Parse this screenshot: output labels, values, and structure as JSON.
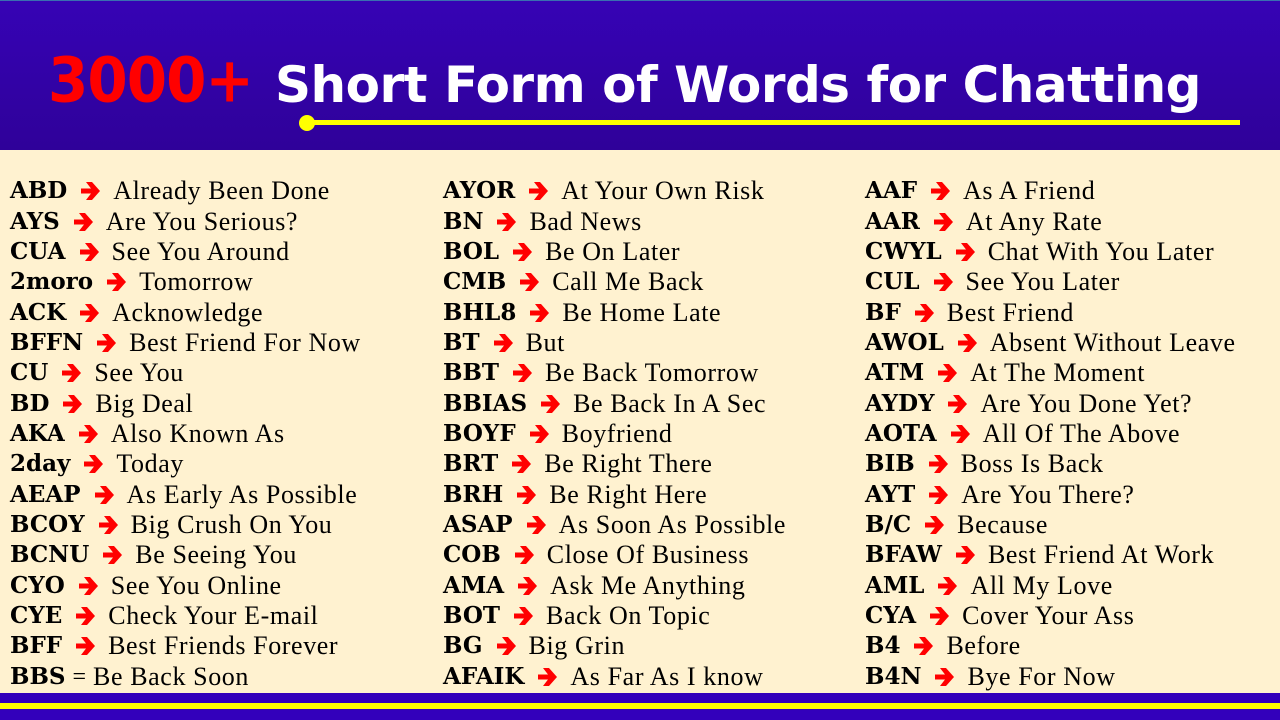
{
  "header": {
    "title_number": "3000+",
    "title_text": "Short Form of Words for Chatting"
  },
  "colors": {
    "header_bg": "#3603b5",
    "number_red": "#ff0000",
    "underline_yellow": "#ffff00",
    "arrow_red": "#ff0000",
    "body_bg": "#fff2d0"
  },
  "columns": [
    {
      "entries": [
        {
          "abbr": "ABD",
          "sep": "arrow",
          "meaning": "Already Been Done"
        },
        {
          "abbr": "AYS",
          "sep": "arrow",
          "meaning": "Are You Serious?"
        },
        {
          "abbr": "CUA",
          "sep": "arrow",
          "meaning": "See You Around"
        },
        {
          "abbr": "2moro",
          "sep": "arrow",
          "meaning": "Tomorrow"
        },
        {
          "abbr": "ACK",
          "sep": "arrow",
          "meaning": "Acknowledge"
        },
        {
          "abbr": "BFFN",
          "sep": "arrow",
          "meaning": "Best Friend For Now"
        },
        {
          "abbr": "CU",
          "sep": "arrow",
          "meaning": "See You"
        },
        {
          "abbr": "BD",
          "sep": "arrow",
          "meaning": "Big Deal"
        },
        {
          "abbr": "AKA",
          "sep": "arrow",
          "meaning": "Also Known As"
        },
        {
          "abbr": "2day",
          "sep": "arrow",
          "meaning": "Today"
        },
        {
          "abbr": "AEAP",
          "sep": "arrow",
          "meaning": "As Early As Possible"
        },
        {
          "abbr": "BCOY",
          "sep": "arrow",
          "meaning": "Big Crush On You"
        },
        {
          "abbr": "BCNU",
          "sep": "arrow",
          "meaning": "Be Seeing You"
        },
        {
          "abbr": "CYO",
          "sep": "arrow",
          "meaning": "See You Online"
        },
        {
          "abbr": "CYE",
          "sep": "arrow",
          "meaning": "Check Your E-mail"
        },
        {
          "abbr": "BFF",
          "sep": "arrow",
          "meaning": "Best Friends Forever"
        },
        {
          "abbr": "BBS",
          "sep": "=",
          "meaning": "Be Back Soon"
        }
      ]
    },
    {
      "entries": [
        {
          "abbr": "AYOR",
          "sep": "arrow",
          "meaning": "At Your Own Risk"
        },
        {
          "abbr": "BN",
          "sep": "arrow",
          "meaning": "Bad News"
        },
        {
          "abbr": "BOL",
          "sep": "arrow",
          "meaning": "Be On Later"
        },
        {
          "abbr": "CMB",
          "sep": "arrow",
          "meaning": "Call Me Back"
        },
        {
          "abbr": "BHL8",
          "sep": "arrow",
          "meaning": "Be Home Late"
        },
        {
          "abbr": "BT",
          "sep": "arrow",
          "meaning": "But"
        },
        {
          "abbr": "BBT",
          "sep": "arrow",
          "meaning": "Be Back Tomorrow"
        },
        {
          "abbr": "BBIAS",
          "sep": "arrow",
          "meaning": "Be Back In A Sec"
        },
        {
          "abbr": "BOYF",
          "sep": "arrow",
          "meaning": "Boyfriend"
        },
        {
          "abbr": "BRT",
          "sep": "arrow",
          "meaning": "Be Right There"
        },
        {
          "abbr": "BRH",
          "sep": "arrow",
          "meaning": "Be Right Here"
        },
        {
          "abbr": "ASAP",
          "sep": "arrow",
          "meaning": "As Soon As Possible"
        },
        {
          "abbr": "COB",
          "sep": "arrow",
          "meaning": "Close Of Business"
        },
        {
          "abbr": "AMA",
          "sep": "arrow",
          "meaning": "Ask Me Anything"
        },
        {
          "abbr": "BOT",
          "sep": "arrow",
          "meaning": "Back On Topic"
        },
        {
          "abbr": "BG",
          "sep": "arrow",
          "meaning": "Big Grin"
        },
        {
          "abbr": "AFAIK",
          "sep": "arrow",
          "meaning": "As Far As I know"
        }
      ]
    },
    {
      "entries": [
        {
          "abbr": "AAF",
          "sep": "arrow",
          "meaning": "As A Friend"
        },
        {
          "abbr": "AAR",
          "sep": "arrow",
          "meaning": "At Any Rate"
        },
        {
          "abbr": "CWYL",
          "sep": "arrow",
          "meaning": "Chat With You Later"
        },
        {
          "abbr": "CUL",
          "sep": "arrow",
          "meaning": "See You Later"
        },
        {
          "abbr": "BF",
          "sep": "arrow",
          "meaning": "Best Friend"
        },
        {
          "abbr": "AWOL",
          "sep": "arrow",
          "meaning": "Absent Without Leave"
        },
        {
          "abbr": "ATM",
          "sep": "arrow",
          "meaning": "At The Moment"
        },
        {
          "abbr": "AYDY",
          "sep": "arrow",
          "meaning": "Are You Done Yet?"
        },
        {
          "abbr": "AOTA",
          "sep": "arrow",
          "meaning": "All Of The Above"
        },
        {
          "abbr": "BIB",
          "sep": "arrow",
          "meaning": "Boss Is Back"
        },
        {
          "abbr": "AYT",
          "sep": "arrow",
          "meaning": "Are You There?"
        },
        {
          "abbr": "B/C",
          "sep": "arrow",
          "meaning": "Because"
        },
        {
          "abbr": "BFAW",
          "sep": "arrow",
          "meaning": "Best Friend At Work"
        },
        {
          "abbr": "AML",
          "sep": "arrow",
          "meaning": "All My Love"
        },
        {
          "abbr": "CYA",
          "sep": "arrow",
          "meaning": "Cover Your Ass"
        },
        {
          "abbr": "B4",
          "sep": "arrow",
          "meaning": "Before"
        },
        {
          "abbr": "B4N",
          "sep": "arrow",
          "meaning": "Bye For Now"
        }
      ]
    }
  ]
}
